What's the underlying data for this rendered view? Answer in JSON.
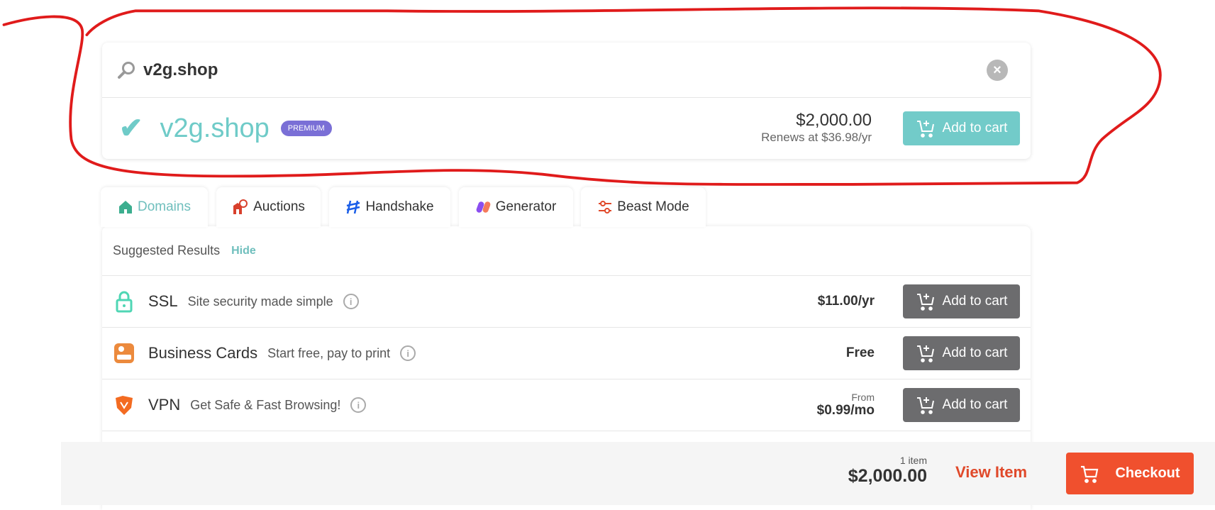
{
  "search": {
    "query": "v2g.shop",
    "icon": "search-icon",
    "clear_icon": "close-icon"
  },
  "result": {
    "domain": "v2g.shop",
    "badge": "PREMIUM",
    "price": "$2,000.00",
    "renewal": "Renews at $36.98/yr",
    "button": "Add to cart",
    "status_icon": "check-icon"
  },
  "tabs": [
    {
      "label": "Domains",
      "icon": "home-icon",
      "active": true
    },
    {
      "label": "Auctions",
      "icon": "auction-icon"
    },
    {
      "label": "Handshake",
      "icon": "handshake-icon"
    },
    {
      "label": "Generator",
      "icon": "generator-icon"
    },
    {
      "label": "Beast Mode",
      "icon": "sliders-icon"
    }
  ],
  "suggested": {
    "title": "Suggested Results",
    "hide": "Hide"
  },
  "items": [
    {
      "title": "SSL",
      "desc": "Site security made simple",
      "price_prefix": "",
      "price": "$11.00/yr",
      "button": "Add to cart",
      "icon": "lock-icon"
    },
    {
      "title": "Business Cards",
      "desc": "Start free, pay to print",
      "price_prefix": "",
      "price": "Free",
      "button": "Add to cart",
      "icon": "business-card-icon"
    },
    {
      "title": "VPN",
      "desc": "Get Safe & Fast Browsing!",
      "price_prefix": "From",
      "price": "$0.99/mo",
      "button": "Add to cart",
      "icon": "vpn-shield-icon"
    }
  ],
  "cart": {
    "count": "1 item",
    "total": "$2,000.00",
    "view": "View Item",
    "checkout": "Checkout"
  },
  "colors": {
    "accent": "#72cbc9",
    "premium": "#7a6fd6",
    "checkout": "#f0502e",
    "annotation": "#e01b1b"
  }
}
